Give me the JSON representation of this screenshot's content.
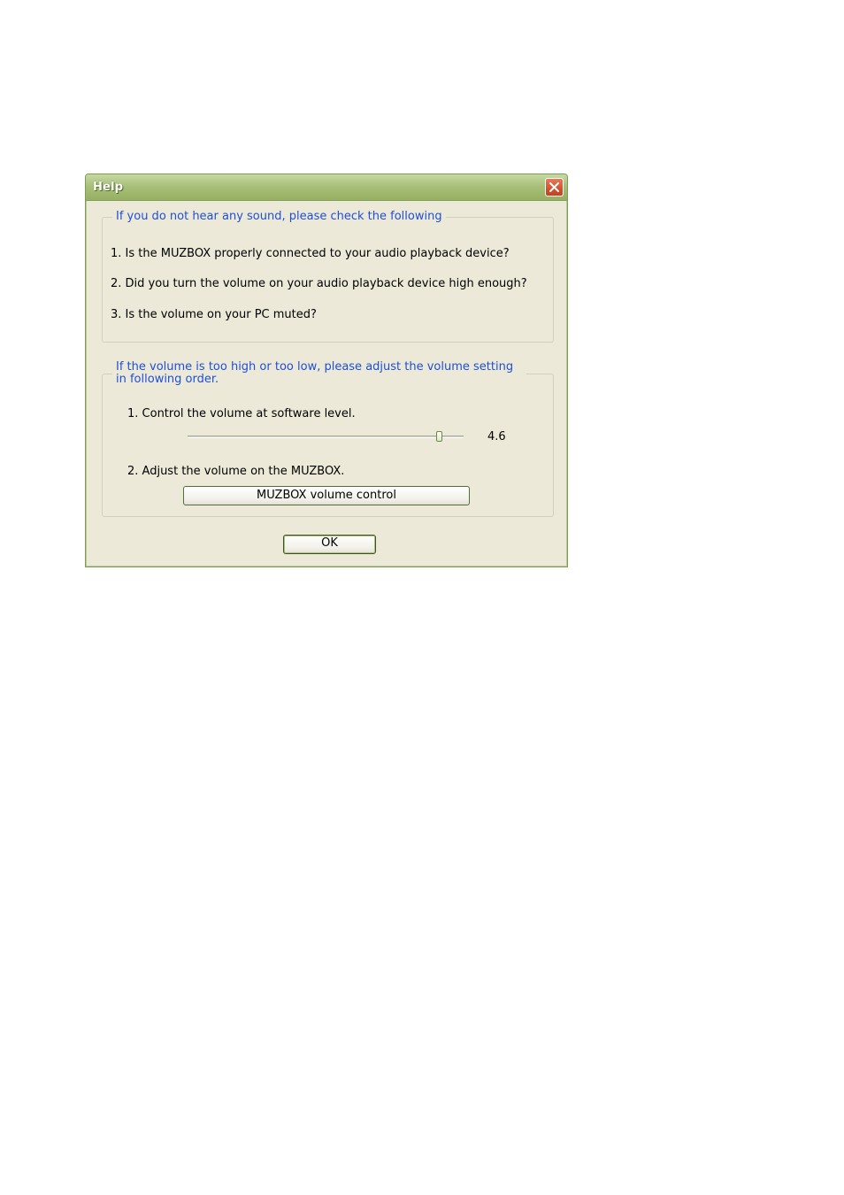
{
  "window": {
    "title": "Help"
  },
  "group1": {
    "legend": "If you do not hear any sound, please check the following",
    "items": [
      "1. Is the MUZBOX properly connected to your audio playback device?",
      "2. Did you turn the volume on your audio playback device high enough?",
      "3. Is the volume on your PC muted?"
    ]
  },
  "group2": {
    "legend_line1": "If the volume is too high or too low, please adjust the volume setting",
    "legend_line2": "in following order.",
    "step1": "1. Control the volume at software level.",
    "slider_value": "4.6",
    "step2": "2. Adjust the volume on the MUZBOX.",
    "muzbox_button": "MUZBOX volume control"
  },
  "ok_button": "OK",
  "colors": {
    "legend_text": "#1f4fd6",
    "titlebar": "#a9c07a",
    "close": "#d2512c",
    "background": "#ece9d8"
  }
}
